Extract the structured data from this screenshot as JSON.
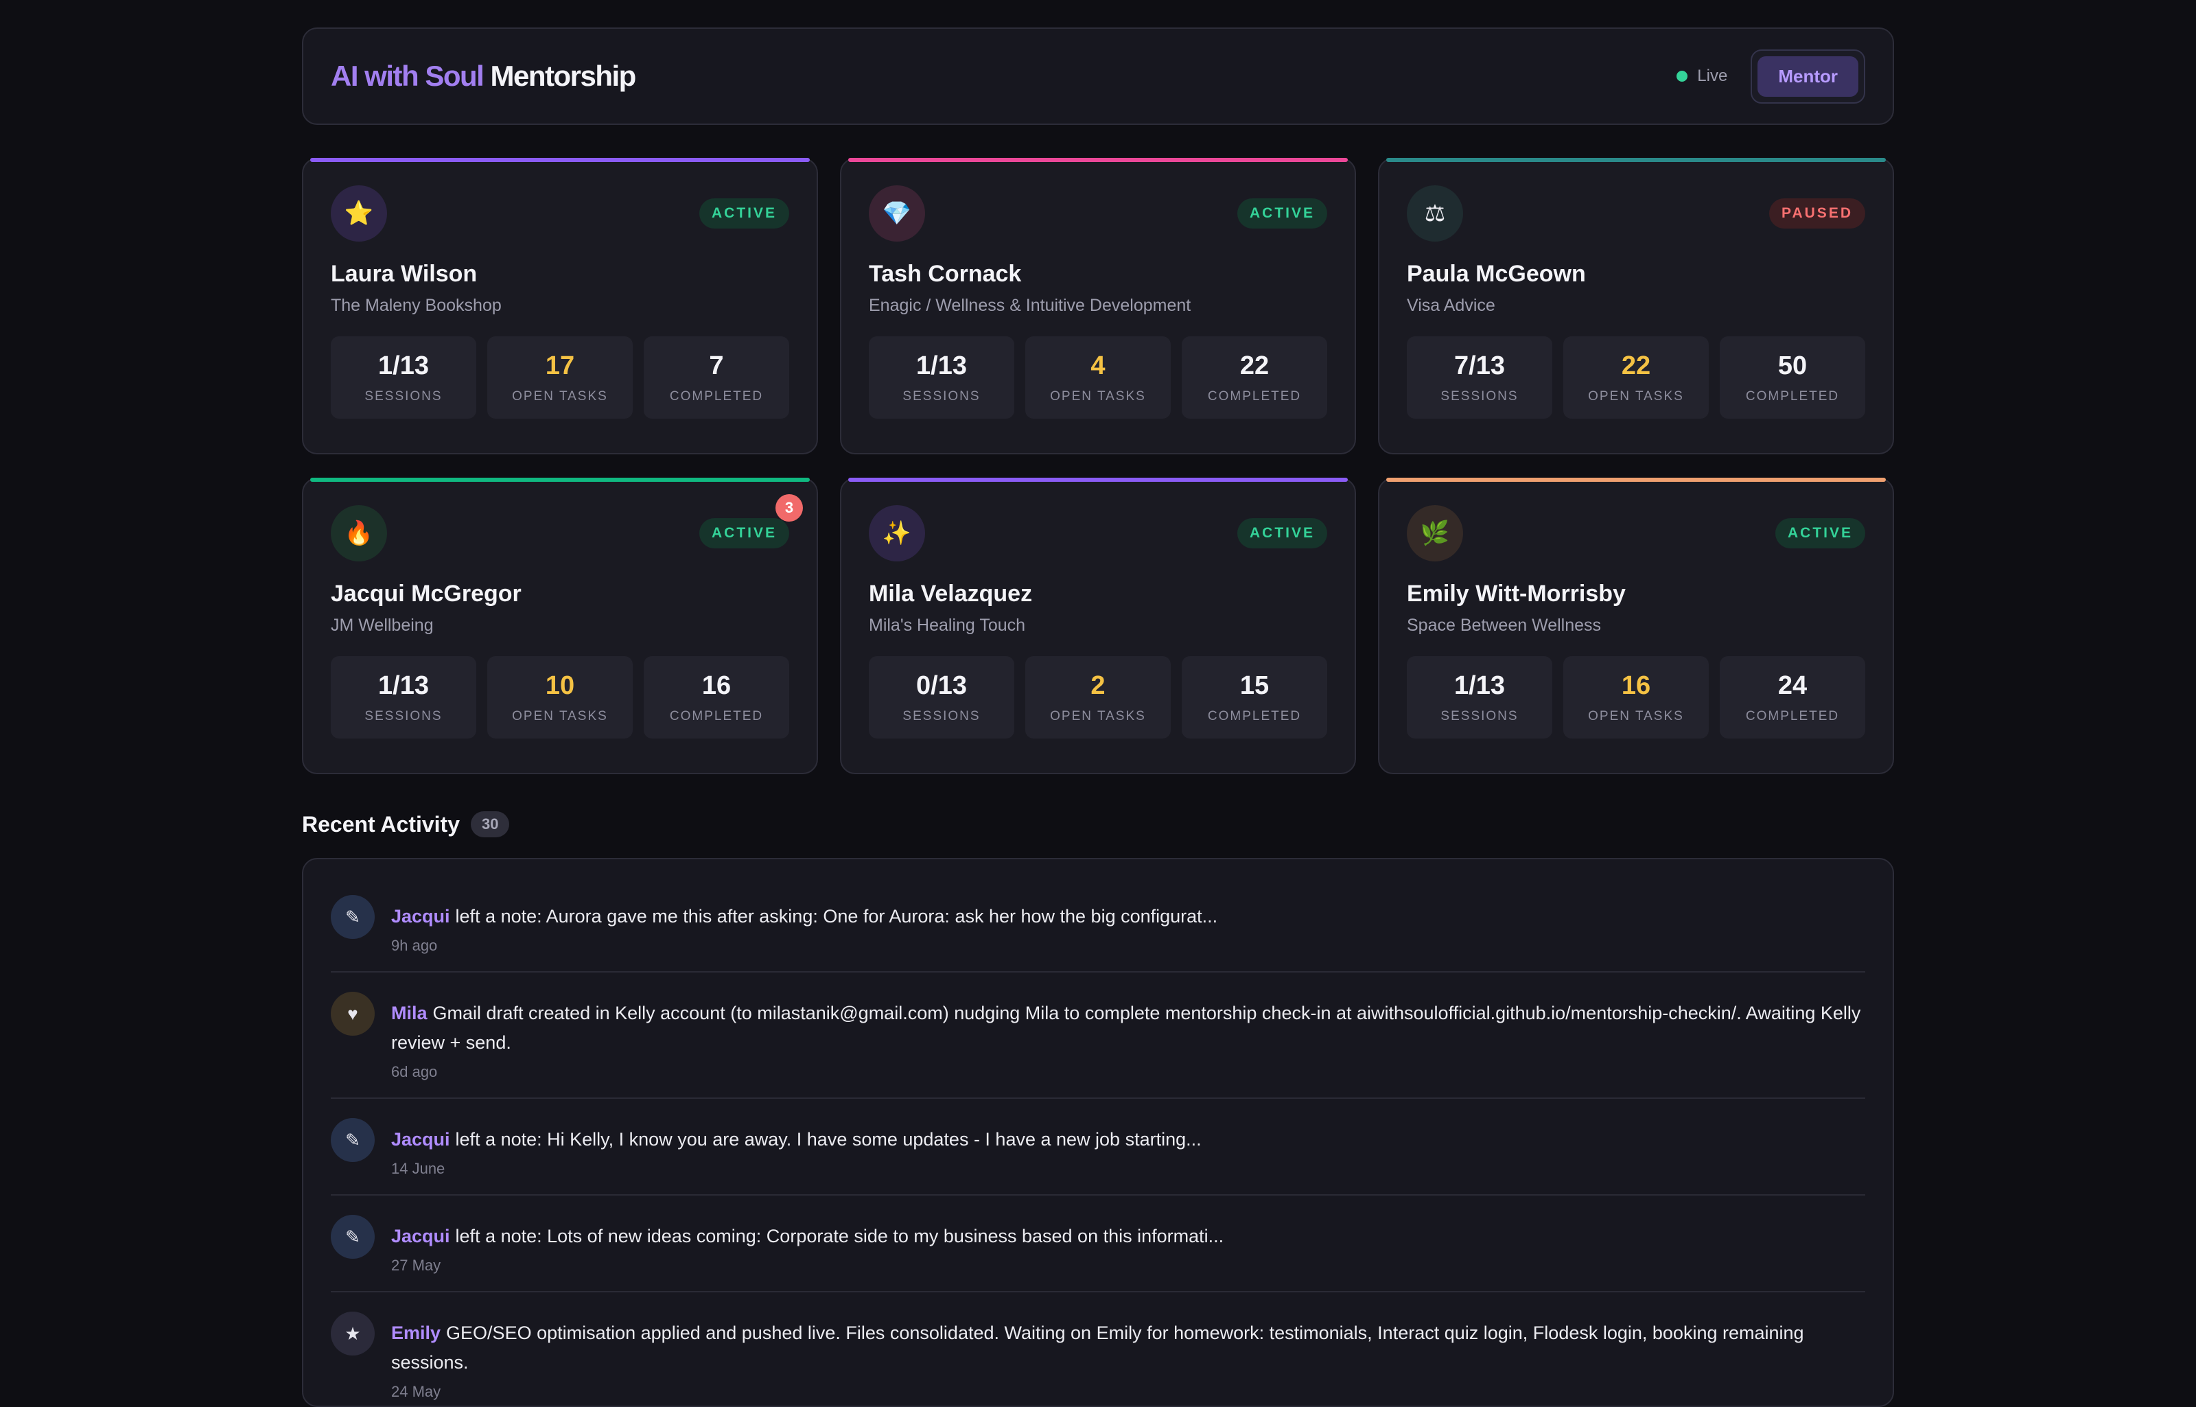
{
  "header": {
    "brand_accent": "AI with Soul",
    "brand_rest": "Mentorship",
    "live_label": "Live",
    "role_label": "Mentor"
  },
  "mentees": [
    {
      "icon": "⭐",
      "icon_name": "star-icon",
      "name": "Laura Wilson",
      "org": "The Maleny Bookshop",
      "status": "ACTIVE",
      "sessions": "1/13",
      "open_tasks": "17",
      "completed": "7",
      "accent": "#8b5cf6",
      "avatar_bg": "#2d2545"
    },
    {
      "icon": "💎",
      "icon_name": "gem-icon",
      "name": "Tash Cornack",
      "org": "Enagic / Wellness & Intuitive Development",
      "status": "ACTIVE",
      "sessions": "1/13",
      "open_tasks": "4",
      "completed": "22",
      "accent": "#ec4899",
      "avatar_bg": "#3a2333"
    },
    {
      "icon": "⚖",
      "icon_name": "scales-icon",
      "name": "Paula McGeown",
      "org": "Visa Advice",
      "status": "PAUSED",
      "sessions": "7/13",
      "open_tasks": "22",
      "completed": "50",
      "accent": "#2a8a8a",
      "avatar_bg": "#1f2c30"
    },
    {
      "icon": "🔥",
      "icon_name": "fire-icon",
      "name": "Jacqui McGregor",
      "org": "JM Wellbeing",
      "status": "ACTIVE",
      "sessions": "1/13",
      "open_tasks": "10",
      "completed": "16",
      "accent": "#10b981",
      "avatar_bg": "#1c3129",
      "notification": "3"
    },
    {
      "icon": "✨",
      "icon_name": "sparkles-icon",
      "name": "Mila Velazquez",
      "org": "Mila's Healing Touch",
      "status": "ACTIVE",
      "sessions": "0/13",
      "open_tasks": "2",
      "completed": "15",
      "accent": "#8b5cf6",
      "avatar_bg": "#2d2545"
    },
    {
      "icon": "🌿",
      "icon_name": "herb-icon",
      "name": "Emily Witt-Morrisby",
      "org": "Space Between Wellness",
      "status": "ACTIVE",
      "sessions": "1/13",
      "open_tasks": "16",
      "completed": "24",
      "accent": "#f0a070",
      "avatar_bg": "#342a27"
    }
  ],
  "stat_labels": {
    "sessions": "SESSIONS",
    "open_tasks": "OPEN TASKS",
    "completed": "COMPLETED"
  },
  "activity": {
    "title": "Recent Activity",
    "count": "30",
    "items": [
      {
        "icon": "✎",
        "icon_name": "pencil-icon",
        "icon_bg": "#26314a",
        "who": "Jacqui",
        "text": "left a note: Aurora gave me this after asking: One for Aurora: ask her how the big configurat...",
        "time": "9h ago"
      },
      {
        "icon": "♥",
        "icon_name": "heart-icon",
        "icon_bg": "#3a3124",
        "who": "Mila",
        "text": "Gmail draft created in Kelly account (to milastanik@gmail.com) nudging Mila to complete mentorship check-in at aiwithsoulofficial.github.io/mentorship-checkin/. Awaiting Kelly review + send.",
        "time": "6d ago"
      },
      {
        "icon": "✎",
        "icon_name": "pencil-icon",
        "icon_bg": "#26314a",
        "who": "Jacqui",
        "text": "left a note: Hi Kelly, I know you are away. I have some updates - I have a new job starting...",
        "time": "14 June"
      },
      {
        "icon": "✎",
        "icon_name": "pencil-icon",
        "icon_bg": "#26314a",
        "who": "Jacqui",
        "text": "left a note: Lots of new ideas coming: Corporate side to my business based on this informati...",
        "time": "27 May"
      },
      {
        "icon": "★",
        "icon_name": "star-icon",
        "icon_bg": "#2b2a3a",
        "who": "Emily",
        "text": "GEO/SEO optimisation applied and pushed live. Files consolidated. Waiting on Emily for homework: testimonials, Interact quiz login, Flodesk login, booking remaining sessions.",
        "time": "24 May"
      }
    ]
  }
}
